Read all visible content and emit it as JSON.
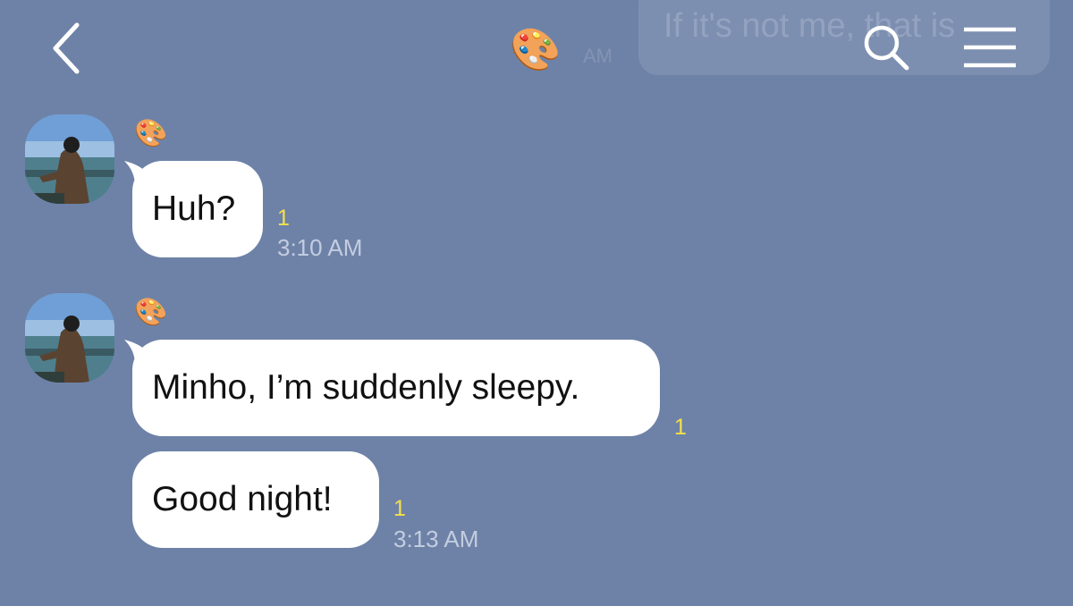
{
  "header": {
    "back_icon": "chevron-left-icon",
    "chat_title_emoji": "🎨",
    "ghost_timestamp": "AM",
    "preview_text": "If it's not me, that is",
    "search_icon": "search-icon",
    "menu_icon": "hamburger-menu-icon"
  },
  "messages": [
    {
      "sender_emoji": "🎨",
      "bubbles": [
        {
          "text": "Huh?",
          "unread": "1",
          "time": "3:10 AM"
        }
      ]
    },
    {
      "sender_emoji": "🎨",
      "bubbles": [
        {
          "text": "Minho, I’m suddenly sleepy.",
          "unread": "1",
          "time": ""
        },
        {
          "text": "Good night!",
          "unread": "1",
          "time": "3:13 AM"
        }
      ]
    }
  ],
  "colors": {
    "background": "#6e82a7",
    "bubble": "#ffffff",
    "unread_count": "#f4e04a",
    "timestamp": "#c3cde0"
  }
}
